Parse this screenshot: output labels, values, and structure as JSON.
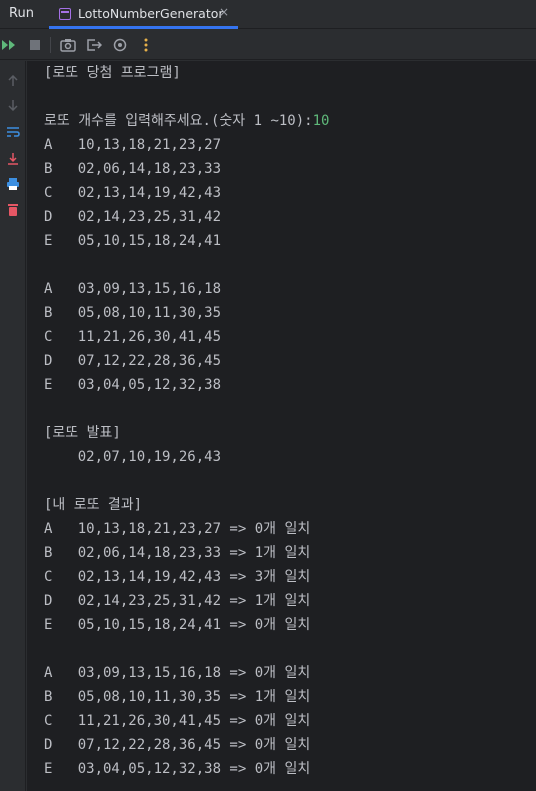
{
  "tabbar": {
    "run_label": "Run",
    "tab_title": "LottoNumberGenerator",
    "close_glyph": "×"
  },
  "toolbar": {
    "icons": [
      "rerun-icon",
      "stop-icon",
      "camera-icon",
      "exit-icon",
      "settings-icon",
      "more-options-icon"
    ]
  },
  "sidebar": {
    "icons": [
      "scroll-up-icon",
      "scroll-down-icon",
      "soft-wrap-icon",
      "scroll-to-end-icon",
      "print-icon",
      "clear-trash-icon"
    ]
  },
  "console": {
    "program_title": "[로또 당첨 프로그램]",
    "prompt": "로또 개수를 입력해주세요.(숫자 1 ~10):",
    "input_value": "10",
    "tickets_group1": [
      "A   10,13,18,21,23,27",
      "B   02,06,14,18,23,33",
      "C   02,13,14,19,42,43",
      "D   02,14,23,25,31,42",
      "E   05,10,15,18,24,41"
    ],
    "tickets_group2": [
      "A   03,09,13,15,16,18",
      "B   05,08,10,11,30,35",
      "C   11,21,26,30,41,45",
      "D   07,12,22,28,36,45",
      "E   03,04,05,12,32,38"
    ],
    "announcement_title": "[로또 발표]",
    "winning_numbers": "    02,07,10,19,26,43",
    "result_title": "[내 로또 결과]",
    "results_group1": [
      "A   10,13,18,21,23,27 => 0개 일치",
      "B   02,06,14,18,23,33 => 1개 일치",
      "C   02,13,14,19,42,43 => 3개 일치",
      "D   02,14,23,25,31,42 => 1개 일치",
      "E   05,10,15,18,24,41 => 0개 일치"
    ],
    "results_group2": [
      "A   03,09,13,15,16,18 => 0개 일치",
      "B   05,08,10,11,30,35 => 1개 일치",
      "C   11,21,26,30,41,45 => 0개 일치",
      "D   07,12,22,28,36,45 => 0개 일치",
      "E   03,04,05,12,32,38 => 0개 일치"
    ]
  },
  "colors": {
    "background": "#1e1f22",
    "panel": "#2b2d30",
    "text": "#bcbec4",
    "input_text": "#5fb87a",
    "run_green": "#5fb87a",
    "accent_blue": "#3574f0",
    "print_blue": "#3d8fe0",
    "trash_red": "#e55765",
    "more_yellow": "#e6b04a"
  }
}
